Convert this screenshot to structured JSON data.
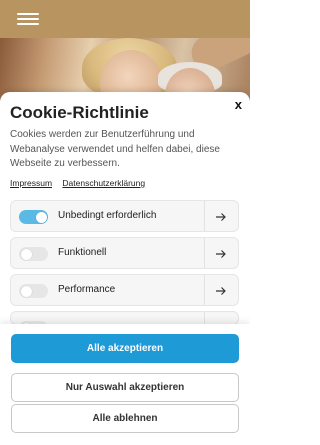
{
  "header": {
    "menu_icon": "hamburger-menu-icon"
  },
  "cookie": {
    "close_label": "x",
    "title": "Cookie-Richtlinie",
    "description": "Cookies werden zur Benutzerführung und Webanalyse verwendet und helfen dabei, diese Webseite zu verbessern.",
    "links": {
      "impressum": "Impressum",
      "datenschutz": "Datenschutzerklärung"
    },
    "options": [
      {
        "label": "Unbedingt erforderlich",
        "enabled": true
      },
      {
        "label": "Funktionell",
        "enabled": false
      },
      {
        "label": "Performance",
        "enabled": false
      }
    ],
    "buttons": {
      "accept_all": "Alle akzeptieren",
      "accept_selection": "Nur Auswahl akzeptieren",
      "reject_all": "Alle ablehnen"
    }
  },
  "colors": {
    "header": "#b89560",
    "accent": "#1e9ad6",
    "toggle_on": "#5bb9e6"
  }
}
